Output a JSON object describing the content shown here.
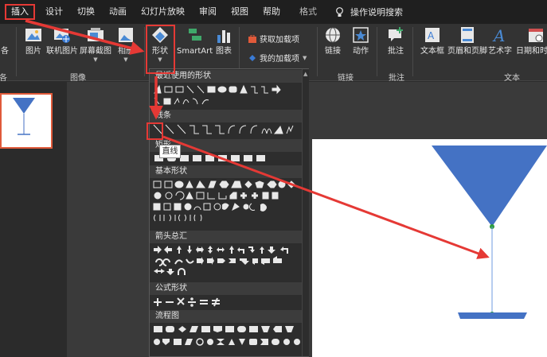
{
  "menu": {
    "tabs": [
      "插入",
      "设计",
      "切换",
      "动画",
      "幻灯片放映",
      "审阅",
      "视图",
      "帮助"
    ],
    "format_tab": "格式",
    "search_label": "操作说明搜索"
  },
  "ribbon": {
    "partial_left_label": "各",
    "buttons": {
      "picture": "图片",
      "online_picture": "联机图片",
      "screenshot": "屏幕截图",
      "album": "相册",
      "shapes": "形状",
      "smartart": "SmartArt",
      "chart": "图表",
      "link": "链接",
      "action": "动作",
      "comment": "批注",
      "textbox": "文本框",
      "header_footer": "页眉和页脚",
      "wordart": "艺术字",
      "datetime": "日期和时间"
    },
    "addins": {
      "get": "获取加载项",
      "my": "我的加载项"
    },
    "groups": {
      "image": "图像",
      "links": "链接",
      "comments": "批注",
      "text": "文本"
    },
    "colors": {
      "accent_red": "#e53935",
      "triangle_blue": "#4472c4"
    }
  },
  "shapes_dropdown": {
    "recent_header": "最近使用的形状",
    "lines_header": "线条",
    "rect_header": "矩形",
    "basic_header": "基本形状",
    "arrows_header": "箭头总汇",
    "equation_header": "公式形状",
    "flowchart_header": "流程图",
    "tooltip": "直线"
  }
}
